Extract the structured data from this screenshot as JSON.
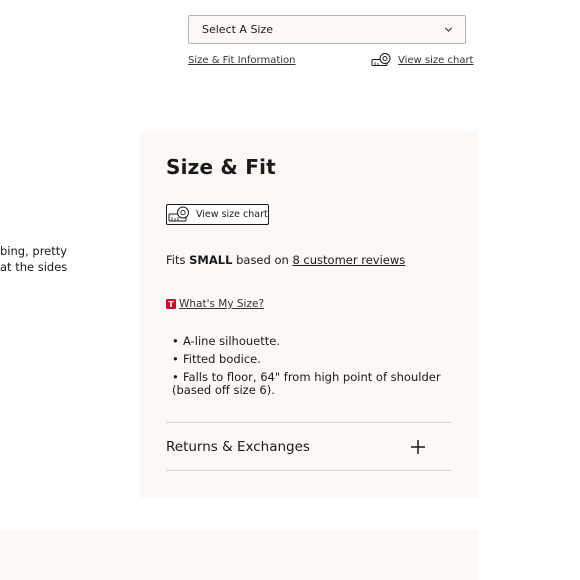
{
  "size_select": {
    "label": "Select A Size"
  },
  "links": {
    "fit_info": "Size & Fit Information",
    "top_size_chart": "View size chart"
  },
  "left_snippet": {
    "line1": "bing, pretty",
    "line2": "at the sides"
  },
  "panel": {
    "title": "Size & Fit",
    "chart_button": "View size chart",
    "fits": {
      "prefix": "Fits ",
      "size": "SMALL",
      "middle": " based on ",
      "reviews": "8 customer reviews"
    },
    "whats_my_size": {
      "badge": "T",
      "label": "What's My Size?"
    },
    "bullets": [
      "A-line silhouette.",
      "Fitted bodice.",
      "Falls to floor, 64\" from high point of shoulder (based off size 6)."
    ],
    "returns": {
      "label": "Returns & Exchanges"
    }
  },
  "colors": {
    "panel_bg": "#fbf8f5",
    "badge": "#c8102e",
    "divider": "#dcd6d0"
  }
}
